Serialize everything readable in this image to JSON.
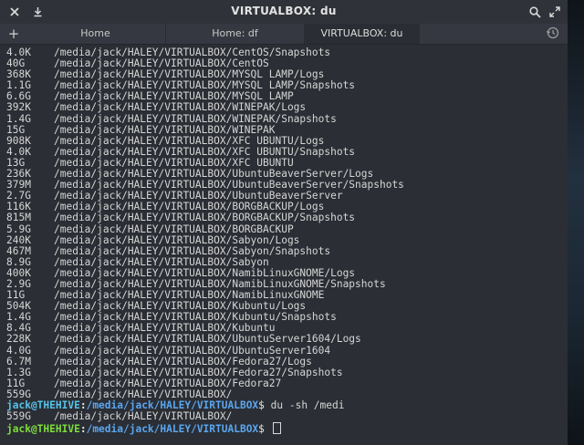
{
  "window": {
    "title": "VIRTUALBOX: du"
  },
  "tabs": [
    {
      "label": "Home",
      "active": false
    },
    {
      "label": "Home: df",
      "active": false
    },
    {
      "label": "VIRTUALBOX: du",
      "active": true
    }
  ],
  "icons": {
    "close": "close-icon",
    "download": "download-icon",
    "search": "search-icon",
    "fullscreen": "fullscreen-icon",
    "add_tab": "plus-icon",
    "history": "history-icon"
  },
  "output": [
    {
      "size": "4.0K",
      "path": "/media/jack/HALEY/VIRTUALBOX/CentOS/Snapshots"
    },
    {
      "size": "40G",
      "path": "/media/jack/HALEY/VIRTUALBOX/CentOS"
    },
    {
      "size": "368K",
      "path": "/media/jack/HALEY/VIRTUALBOX/MYSQL LAMP/Logs"
    },
    {
      "size": "1.1G",
      "path": "/media/jack/HALEY/VIRTUALBOX/MYSQL LAMP/Snapshots"
    },
    {
      "size": "6.6G",
      "path": "/media/jack/HALEY/VIRTUALBOX/MYSQL LAMP"
    },
    {
      "size": "392K",
      "path": "/media/jack/HALEY/VIRTUALBOX/WINEPAK/Logs"
    },
    {
      "size": "1.4G",
      "path": "/media/jack/HALEY/VIRTUALBOX/WINEPAK/Snapshots"
    },
    {
      "size": "15G",
      "path": "/media/jack/HALEY/VIRTUALBOX/WINEPAK"
    },
    {
      "size": "908K",
      "path": "/media/jack/HALEY/VIRTUALBOX/XFC UBUNTU/Logs"
    },
    {
      "size": "4.0K",
      "path": "/media/jack/HALEY/VIRTUALBOX/XFC UBUNTU/Snapshots"
    },
    {
      "size": "13G",
      "path": "/media/jack/HALEY/VIRTUALBOX/XFC UBUNTU"
    },
    {
      "size": "236K",
      "path": "/media/jack/HALEY/VIRTUALBOX/UbuntuBeaverServer/Logs"
    },
    {
      "size": "379M",
      "path": "/media/jack/HALEY/VIRTUALBOX/UbuntuBeaverServer/Snapshots"
    },
    {
      "size": "2.7G",
      "path": "/media/jack/HALEY/VIRTUALBOX/UbuntuBeaverServer"
    },
    {
      "size": "116K",
      "path": "/media/jack/HALEY/VIRTUALBOX/BORGBACKUP/Logs"
    },
    {
      "size": "815M",
      "path": "/media/jack/HALEY/VIRTUALBOX/BORGBACKUP/Snapshots"
    },
    {
      "size": "5.9G",
      "path": "/media/jack/HALEY/VIRTUALBOX/BORGBACKUP"
    },
    {
      "size": "240K",
      "path": "/media/jack/HALEY/VIRTUALBOX/Sabyon/Logs"
    },
    {
      "size": "467M",
      "path": "/media/jack/HALEY/VIRTUALBOX/Sabyon/Snapshots"
    },
    {
      "size": "8.9G",
      "path": "/media/jack/HALEY/VIRTUALBOX/Sabyon"
    },
    {
      "size": "400K",
      "path": "/media/jack/HALEY/VIRTUALBOX/NamibLinuxGNOME/Logs"
    },
    {
      "size": "2.9G",
      "path": "/media/jack/HALEY/VIRTUALBOX/NamibLinuxGNOME/Snapshots"
    },
    {
      "size": "11G",
      "path": "/media/jack/HALEY/VIRTUALBOX/NamibLinuxGNOME"
    },
    {
      "size": "504K",
      "path": "/media/jack/HALEY/VIRTUALBOX/Kubuntu/Logs"
    },
    {
      "size": "1.4G",
      "path": "/media/jack/HALEY/VIRTUALBOX/Kubuntu/Snapshots"
    },
    {
      "size": "8.4G",
      "path": "/media/jack/HALEY/VIRTUALBOX/Kubuntu"
    },
    {
      "size": "228K",
      "path": "/media/jack/HALEY/VIRTUALBOX/UbuntuServer1604/Logs"
    },
    {
      "size": "4.0G",
      "path": "/media/jack/HALEY/VIRTUALBOX/UbuntuServer1604"
    },
    {
      "size": "6.7M",
      "path": "/media/jack/HALEY/VIRTUALBOX/Fedora27/Logs"
    },
    {
      "size": "1.3G",
      "path": "/media/jack/HALEY/VIRTUALBOX/Fedora27/Snapshots"
    },
    {
      "size": "11G",
      "path": "/media/jack/HALEY/VIRTUALBOX/Fedora27"
    },
    {
      "size": "559G",
      "path": "/media/jack/HALEY/VIRTUALBOX/"
    }
  ],
  "prompt1": {
    "user": "jack@THEHIVE",
    "sep": ":",
    "path": "/media/jack/HALEY/VIRTUALBOX",
    "dollar": "$ ",
    "command": "du -sh /medi"
  },
  "result": {
    "size": "559G",
    "path": "/media/jack/HALEY/VIRTUALBOX/"
  },
  "prompt2": {
    "user": "jack@THEHIVE",
    "sep": ":",
    "path": "/media/jack/HALEY/VIRTUALBOX",
    "dollar": "$ "
  },
  "colors": {
    "terminal_bg": "#2b2e34",
    "prompt_user_cyan": "#55c2e8",
    "prompt_user_green": "#7ddc3d",
    "prompt_path": "#5aa6f0"
  }
}
